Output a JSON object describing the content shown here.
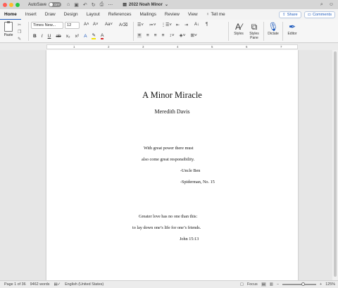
{
  "window": {
    "autosave_label": "AutoSave",
    "autosave_state": "OFF",
    "doc_title": "2022 Noah Minor"
  },
  "tabs": [
    "Home",
    "Insert",
    "Draw",
    "Design",
    "Layout",
    "References",
    "Mailings",
    "Review",
    "View"
  ],
  "tell_me": "Tell me",
  "share_label": "Share",
  "comments_label": "Comments",
  "ribbon": {
    "paste_label": "Paste",
    "font_name": "Times New...",
    "font_size": "12",
    "styles_label": "Styles",
    "styles_pane_label": "Styles Pane",
    "dictate_label": "Dictate",
    "editor_label": "Editor"
  },
  "ruler_numbers": [
    "1",
    "2",
    "3",
    "4",
    "5",
    "6",
    "7"
  ],
  "document": {
    "title": "A Minor Miracle",
    "author": "Meredith Davis",
    "epigraph1": [
      "With great power there must",
      "also come great responsibility.",
      "-Uncle Ben",
      "-Spiderman, No. 15"
    ],
    "epigraph2": [
      "Greater love has no one than this:",
      "to lay down one’s life for one’s friends.",
      "John 15:13"
    ]
  },
  "statusbar": {
    "page": "Page 1 of 36",
    "words": "9462 words",
    "language": "English (United States)",
    "focus": "Focus",
    "zoom": "125%",
    "zoom_level_fraction": 0.62
  }
}
